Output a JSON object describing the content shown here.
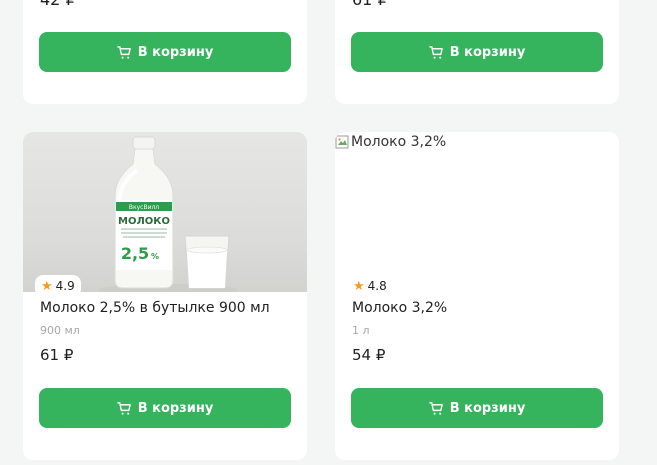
{
  "cart_button_label": "В корзину",
  "top_row": [
    {
      "price": "42 ₽"
    },
    {
      "price": "61 ₽"
    }
  ],
  "products": [
    {
      "name": "Молоко 2,5% в бутылке 900 мл",
      "weight": "900 мл",
      "price": "61 ₽",
      "rating": "4.9",
      "brand": "ВкусВилл",
      "label_text": "МОЛОКО",
      "label_percent": "2,5",
      "label_unit": "%"
    },
    {
      "name": "Молоко 3,2%",
      "weight": "1 л",
      "price": "54 ₽",
      "rating": "4.8",
      "image_alt": "Молоко 3,2%"
    }
  ],
  "colors": {
    "accent": "#36b45d",
    "star": "#f59a23",
    "background": "#f4f6f5"
  }
}
